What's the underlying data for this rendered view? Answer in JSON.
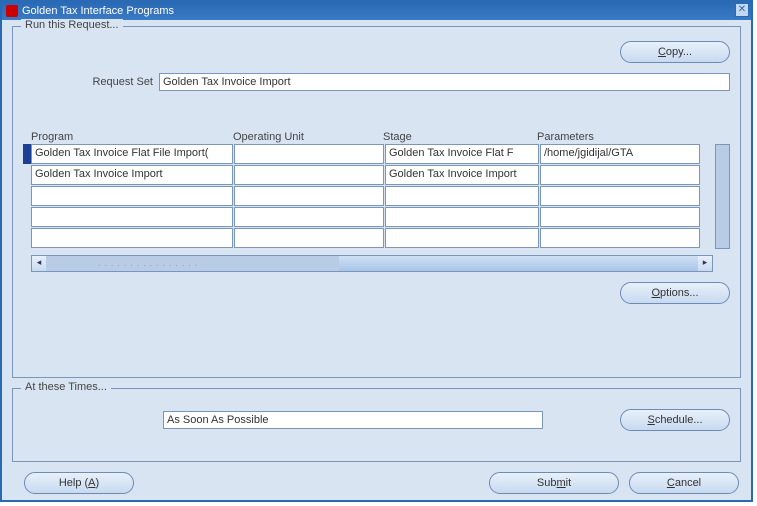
{
  "window": {
    "title": "Golden Tax Interface Programs",
    "close_glyph": "✕"
  },
  "run_request": {
    "legend": "Run this Request...",
    "copy_label": "Copy...",
    "request_set_label": "Request Set",
    "request_set_value": "Golden Tax Invoice Import",
    "columns": {
      "program": "Program",
      "operating_unit": "Operating Unit",
      "stage": "Stage",
      "parameters": "Parameters"
    },
    "rows": [
      {
        "program": "Golden Tax Invoice Flat File Import(",
        "operating_unit": "",
        "stage": "Golden Tax Invoice Flat F",
        "parameters": "/home/jgidijal/GTA"
      },
      {
        "program": "Golden Tax Invoice Import",
        "operating_unit": "",
        "stage": "Golden Tax Invoice Import",
        "parameters": ""
      },
      {
        "program": "",
        "operating_unit": "",
        "stage": "",
        "parameters": ""
      },
      {
        "program": "",
        "operating_unit": "",
        "stage": "",
        "parameters": ""
      },
      {
        "program": "",
        "operating_unit": "",
        "stage": "",
        "parameters": ""
      }
    ],
    "options_label": "Options..."
  },
  "times": {
    "legend": "At these Times...",
    "value": "As Soon As Possible",
    "schedule_label": "Schedule..."
  },
  "footer": {
    "help_label": "Help (A)",
    "submit_label": "Submit",
    "cancel_label": "Cancel"
  },
  "scroll": {
    "left": "◂",
    "right": "▸"
  }
}
